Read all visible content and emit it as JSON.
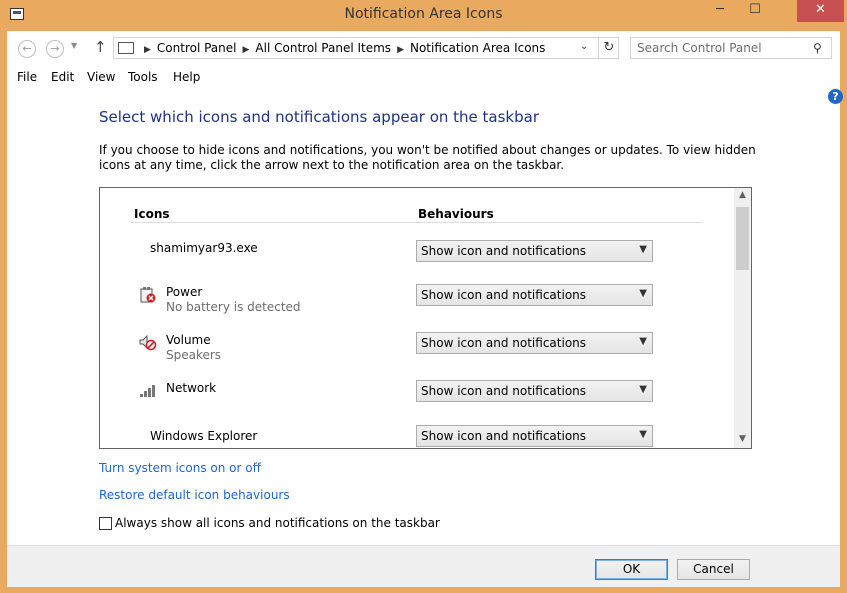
{
  "window": {
    "title": "Notification Area Icons",
    "minimize_glyph": "─",
    "maximize_glyph": "☐",
    "close_glyph": "✕"
  },
  "address": {
    "breadcrumbs": [
      "Control Panel",
      "All Control Panel Items",
      "Notification Area Icons"
    ],
    "search_placeholder": "Search Control Panel"
  },
  "menu": [
    "File",
    "Edit",
    "View",
    "Tools",
    "Help"
  ],
  "main": {
    "heading": "Select which icons and notifications appear on the taskbar",
    "description": "If you choose to hide icons and notifications, you won't be notified about changes or updates. To view hidden icons at any time, click the arrow next to the notification area on the taskbar."
  },
  "table": {
    "headers": [
      "Icons",
      "Behaviours"
    ],
    "rows": [
      {
        "name": "shamimyar93.exe",
        "sub": "",
        "icon": "none",
        "behaviour": "Show icon and notifications"
      },
      {
        "name": "Power",
        "sub": "No battery is detected",
        "icon": "power-plug-icon",
        "behaviour": "Show icon and notifications"
      },
      {
        "name": "Volume",
        "sub": "Speakers",
        "icon": "speaker-muted-icon",
        "behaviour": "Show icon and notifications"
      },
      {
        "name": "Network",
        "sub": "",
        "icon": "network-signal-icon",
        "behaviour": "Show icon and notifications"
      },
      {
        "name": "Windows Explorer",
        "sub": "",
        "icon": "none",
        "behaviour": "Show icon and notifications"
      }
    ]
  },
  "links": {
    "system_icons": "Turn system icons on or off",
    "restore": "Restore default icon behaviours"
  },
  "always_show": {
    "label": "Always show all icons and notifications on the taskbar",
    "checked": false
  },
  "buttons": {
    "ok": "OK",
    "cancel": "Cancel"
  }
}
